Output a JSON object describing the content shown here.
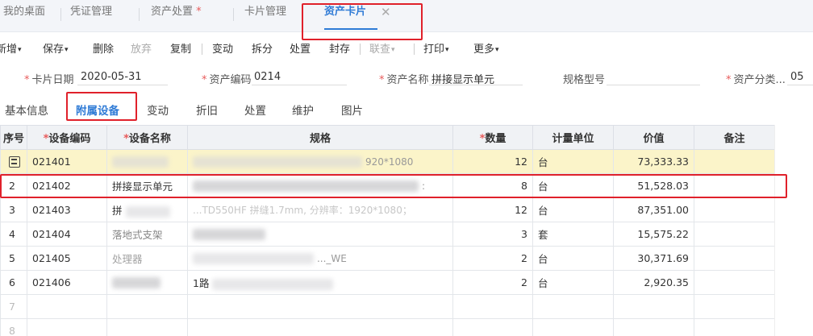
{
  "tabs": [
    {
      "label": "我的桌面",
      "modified": false,
      "active": false
    },
    {
      "label": "凭证管理",
      "modified": false,
      "active": false
    },
    {
      "label": "资产处置",
      "modified": true,
      "active": false
    },
    {
      "label": "卡片管理",
      "modified": false,
      "active": false
    },
    {
      "label": "资产卡片",
      "modified": false,
      "active": true
    }
  ],
  "tab_modified_mark": "*",
  "tab_close_glyph": "✕",
  "toolbar": [
    {
      "label": "新增",
      "dropdown": true,
      "disabled": false
    },
    {
      "label": "保存",
      "dropdown": true,
      "disabled": false
    },
    {
      "label": "删除",
      "dropdown": false,
      "disabled": false
    },
    {
      "label": "放弃",
      "dropdown": false,
      "disabled": true
    },
    {
      "label": "复制",
      "dropdown": false,
      "disabled": false
    },
    {
      "label": "变动",
      "dropdown": false,
      "disabled": false
    },
    {
      "label": "拆分",
      "dropdown": false,
      "disabled": false
    },
    {
      "label": "处置",
      "dropdown": false,
      "disabled": false
    },
    {
      "label": "封存",
      "dropdown": false,
      "disabled": false
    },
    {
      "label": "联查",
      "dropdown": true,
      "disabled": true
    },
    {
      "label": "打印",
      "dropdown": true,
      "disabled": false
    },
    {
      "label": "更多",
      "dropdown": true,
      "disabled": false
    }
  ],
  "caret_glyph": "▾",
  "form": {
    "card_date": {
      "label": "卡片日期",
      "value": "2020-05-31",
      "required": true
    },
    "asset_code": {
      "label": "资产编码",
      "value": "0214",
      "required": true
    },
    "asset_name": {
      "label": "资产名称",
      "value": "拼接显示单元",
      "required": true
    },
    "spec_model": {
      "label": "规格型号",
      "value": "",
      "required": false
    },
    "asset_category": {
      "label": "资产分类...",
      "value": "05",
      "required": true
    }
  },
  "required_mark": "*",
  "subtabs": [
    "基本信息",
    "附属设备",
    "变动",
    "折旧",
    "处置",
    "维护",
    "图片"
  ],
  "active_subtab": "附属设备",
  "table": {
    "columns": [
      {
        "label": "序号",
        "required": false
      },
      {
        "label": "设备编码",
        "required": true
      },
      {
        "label": "设备名称",
        "required": true
      },
      {
        "label": "规格",
        "required": false
      },
      {
        "label": "数量",
        "required": true
      },
      {
        "label": "计量单位",
        "required": false
      },
      {
        "label": "价值",
        "required": false
      },
      {
        "label": "备注",
        "required": false
      }
    ],
    "rows": [
      {
        "seq": "",
        "code": "021401",
        "name": "",
        "spec": "920*1080",
        "qty": "12",
        "unit": "台",
        "value": "73,333.33",
        "note": ""
      },
      {
        "seq": "2",
        "code": "021402",
        "name": "拼接显示单元",
        "spec": ":",
        "qty": "8",
        "unit": "台",
        "value": "51,528.03",
        "note": ""
      },
      {
        "seq": "3",
        "code": "021403",
        "name": "拼",
        "spec": "...TD550HF 拼缝1.7mm, 分辨率：1920*1080；",
        "qty": "12",
        "unit": "台",
        "value": "87,351.00",
        "note": ""
      },
      {
        "seq": "4",
        "code": "021404",
        "name": "落地式支架",
        "spec": "",
        "qty": "3",
        "unit": "套",
        "value": "15,575.22",
        "note": ""
      },
      {
        "seq": "5",
        "code": "021405",
        "name": "处理器",
        "spec": "..._WE",
        "qty": "2",
        "unit": "台",
        "value": "30,371.69",
        "note": ""
      },
      {
        "seq": "6",
        "code": "021406",
        "name": "",
        "spec": "1路",
        "qty": "2",
        "unit": "台",
        "value": "2,920.35",
        "note": ""
      },
      {
        "seq": "7",
        "code": "",
        "name": "",
        "spec": "",
        "qty": "",
        "unit": "",
        "value": "",
        "note": ""
      },
      {
        "seq": "8",
        "code": "",
        "name": "",
        "spec": "",
        "qty": "",
        "unit": "",
        "value": "",
        "note": ""
      }
    ]
  },
  "colors": {
    "accent": "#2f7bd6",
    "highlight_box": "#e0212b",
    "required": "#e85b5b",
    "hover_row": "#fbf4c9"
  }
}
